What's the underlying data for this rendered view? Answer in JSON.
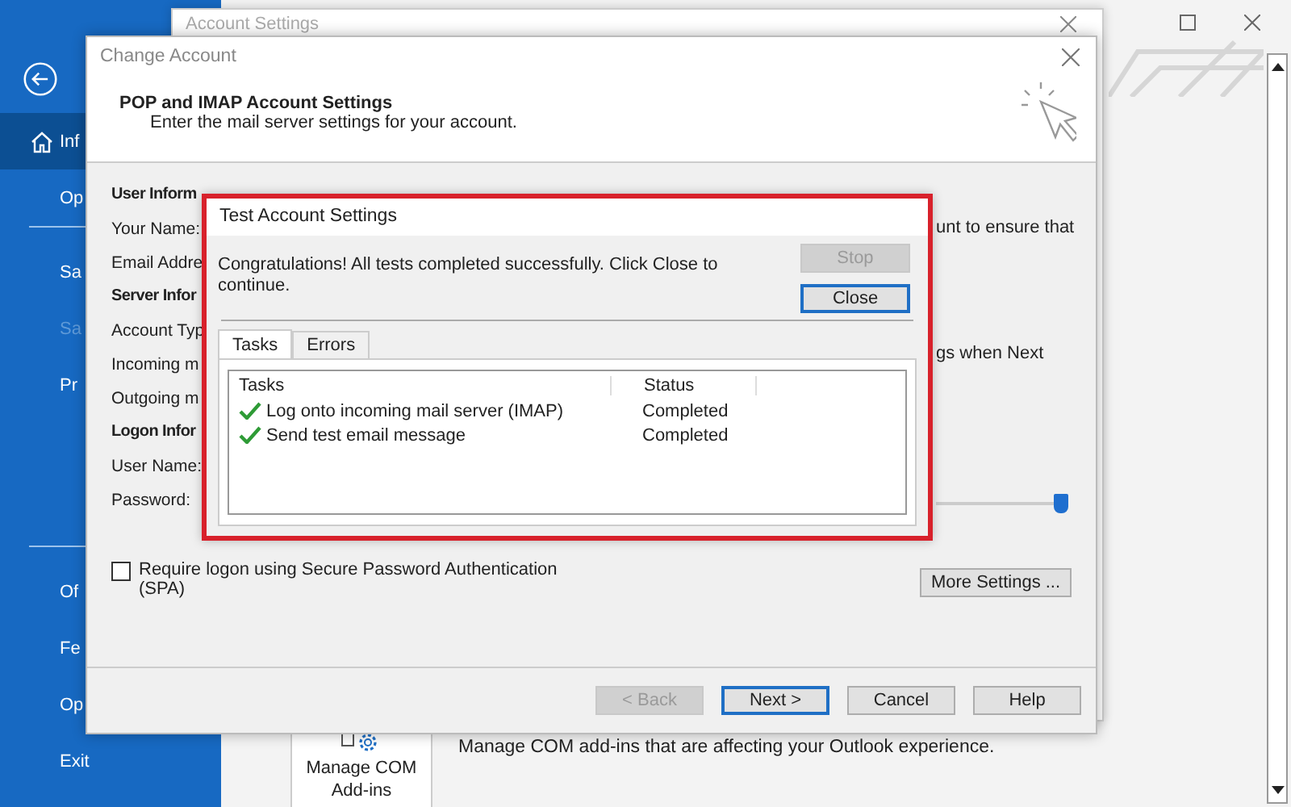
{
  "outlook": {
    "sidebar": [
      {
        "label": "Inf",
        "selected": true,
        "disabled": false
      },
      {
        "label": "Op",
        "selected": false,
        "disabled": false
      },
      {
        "label": "Sa",
        "selected": false,
        "disabled": false
      },
      {
        "label": "Sa",
        "selected": false,
        "disabled": true
      },
      {
        "label": "Pr",
        "selected": false,
        "disabled": false
      },
      {
        "label": "Of",
        "selected": false,
        "disabled": false
      },
      {
        "label": "Fe",
        "selected": false,
        "disabled": false
      },
      {
        "label": "Op",
        "selected": false,
        "disabled": false
      },
      {
        "label": "Exit",
        "selected": false,
        "disabled": false
      }
    ],
    "addin": {
      "label": "Manage COM Add-ins",
      "description": "Manage COM add-ins that are affecting your Outlook experience."
    }
  },
  "account_settings": {
    "title": "Account Settings"
  },
  "change_account": {
    "title": "Change Account",
    "heading": "POP and IMAP Account Settings",
    "subheading": "Enter the mail server settings for your account.",
    "labels": [
      {
        "text": "User Inform",
        "kind": "section"
      },
      {
        "text": "Your Name:",
        "kind": "field"
      },
      {
        "text": "Email Addre",
        "kind": "field"
      },
      {
        "text": "Server Infor",
        "kind": "section"
      },
      {
        "text": "Account Typ",
        "kind": "field"
      },
      {
        "text": "Incoming m",
        "kind": "field"
      },
      {
        "text": "Outgoing m",
        "kind": "field"
      },
      {
        "text": "Logon Infor",
        "kind": "section"
      },
      {
        "text": "User Name:",
        "kind": "field"
      },
      {
        "text": "Password:",
        "kind": "field"
      }
    ],
    "right_texts": [
      "unt to ensure that",
      "gs when Next"
    ],
    "slider": {
      "level": 1
    },
    "spa": {
      "label": "Require logon using Secure Password Authentication (SPA)",
      "checked": false
    },
    "more_settings": "More Settings ...",
    "buttons": [
      {
        "label": "< Back",
        "disabled": true,
        "default": false
      },
      {
        "label": "Next >",
        "disabled": false,
        "default": true
      },
      {
        "label": "Cancel",
        "disabled": false,
        "default": false
      },
      {
        "label": "Help",
        "disabled": false,
        "default": false
      }
    ]
  },
  "test_dialog": {
    "title": "Test Account Settings",
    "message": "Congratulations! All tests completed successfully. Click Close to continue.",
    "buttons": [
      {
        "label": "Stop",
        "disabled": true,
        "default": false
      },
      {
        "label": "Close",
        "disabled": false,
        "default": true
      }
    ],
    "tabs": [
      {
        "label": "Tasks",
        "selected": true
      },
      {
        "label": "Errors",
        "selected": false
      }
    ],
    "columns": [
      "Tasks",
      "Status"
    ],
    "rows": [
      {
        "task": "Log onto incoming mail server (IMAP)",
        "status": "Completed",
        "done": true
      },
      {
        "task": "Send test email message",
        "status": "Completed",
        "done": true
      }
    ]
  }
}
